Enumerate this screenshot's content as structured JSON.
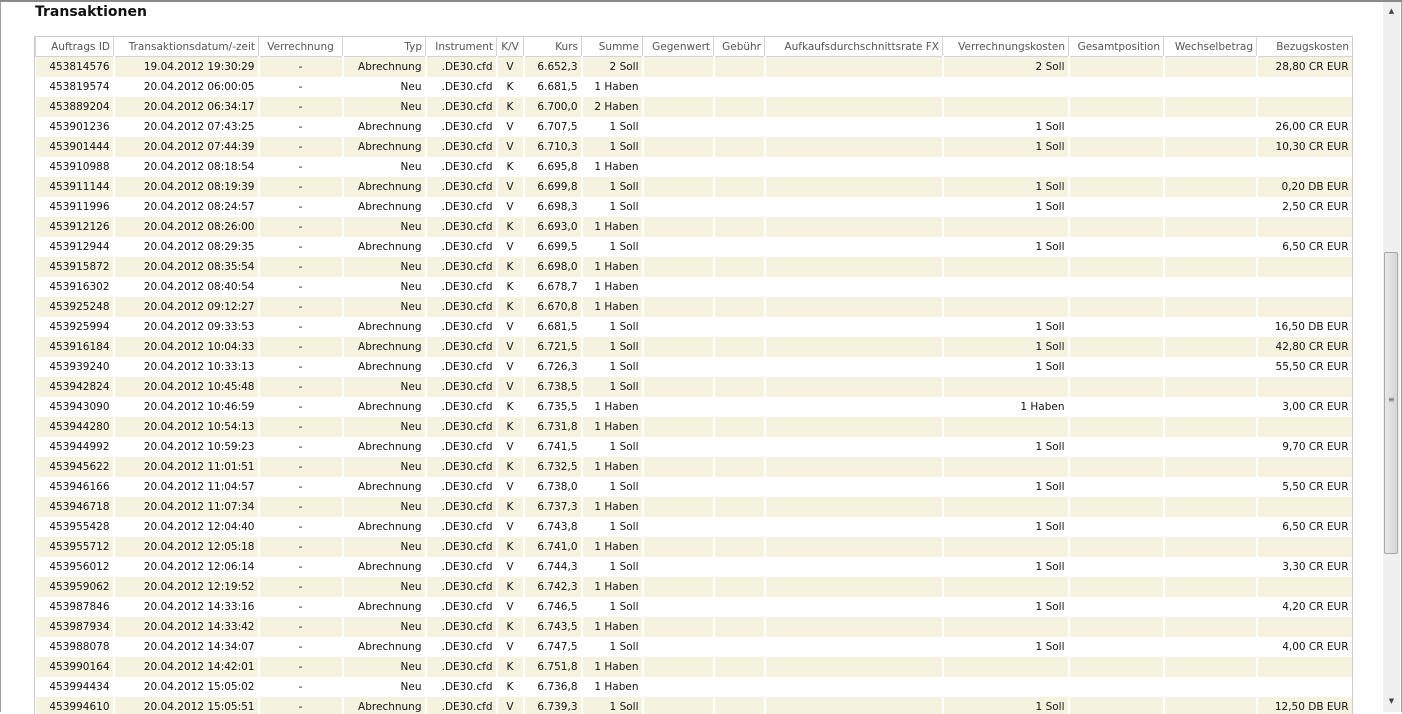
{
  "title": "Transaktionen",
  "table": {
    "columns": [
      "Auftrags ID",
      "Transaktionsdatum/-zeit",
      "Verrechnung",
      "Typ",
      "Instrument",
      "K/V",
      "Kurs",
      "Summe",
      "Gegenwert",
      "Gebühr",
      "Aufkaufsdurchschnittsrate FX",
      "Verrechnungskosten",
      "Gesamtposition",
      "Wechselbetrag",
      "Bezugskosten"
    ],
    "rows": [
      [
        "453814576",
        "19.04.2012 19:30:29",
        "-",
        "Abrechnung",
        ".DE30.cfd",
        "V",
        "6.652,3",
        "2 Soll",
        "",
        "",
        "",
        "2 Soll",
        "",
        "",
        "28,80 CR EUR"
      ],
      [
        "453819574",
        "20.04.2012 06:00:05",
        "-",
        "Neu",
        ".DE30.cfd",
        "K",
        "6.681,5",
        "1 Haben",
        "",
        "",
        "",
        "",
        "",
        "",
        ""
      ],
      [
        "453889204",
        "20.04.2012 06:34:17",
        "-",
        "Neu",
        ".DE30.cfd",
        "K",
        "6.700,0",
        "2 Haben",
        "",
        "",
        "",
        "",
        "",
        "",
        ""
      ],
      [
        "453901236",
        "20.04.2012 07:43:25",
        "-",
        "Abrechnung",
        ".DE30.cfd",
        "V",
        "6.707,5",
        "1 Soll",
        "",
        "",
        "",
        "1 Soll",
        "",
        "",
        "26,00 CR EUR"
      ],
      [
        "453901444",
        "20.04.2012 07:44:39",
        "-",
        "Abrechnung",
        ".DE30.cfd",
        "V",
        "6.710,3",
        "1 Soll",
        "",
        "",
        "",
        "1 Soll",
        "",
        "",
        "10,30 CR EUR"
      ],
      [
        "453910988",
        "20.04.2012 08:18:54",
        "-",
        "Neu",
        ".DE30.cfd",
        "K",
        "6.695,8",
        "1 Haben",
        "",
        "",
        "",
        "",
        "",
        "",
        ""
      ],
      [
        "453911144",
        "20.04.2012 08:19:39",
        "-",
        "Abrechnung",
        ".DE30.cfd",
        "V",
        "6.699,8",
        "1 Soll",
        "",
        "",
        "",
        "1 Soll",
        "",
        "",
        "0,20 DB EUR"
      ],
      [
        "453911996",
        "20.04.2012 08:24:57",
        "-",
        "Abrechnung",
        ".DE30.cfd",
        "V",
        "6.698,3",
        "1 Soll",
        "",
        "",
        "",
        "1 Soll",
        "",
        "",
        "2,50 CR EUR"
      ],
      [
        "453912126",
        "20.04.2012 08:26:00",
        "-",
        "Neu",
        ".DE30.cfd",
        "K",
        "6.693,0",
        "1 Haben",
        "",
        "",
        "",
        "",
        "",
        "",
        ""
      ],
      [
        "453912944",
        "20.04.2012 08:29:35",
        "-",
        "Abrechnung",
        ".DE30.cfd",
        "V",
        "6.699,5",
        "1 Soll",
        "",
        "",
        "",
        "1 Soll",
        "",
        "",
        "6,50 CR EUR"
      ],
      [
        "453915872",
        "20.04.2012 08:35:54",
        "-",
        "Neu",
        ".DE30.cfd",
        "K",
        "6.698,0",
        "1 Haben",
        "",
        "",
        "",
        "",
        "",
        "",
        ""
      ],
      [
        "453916302",
        "20.04.2012 08:40:54",
        "-",
        "Neu",
        ".DE30.cfd",
        "K",
        "6.678,7",
        "1 Haben",
        "",
        "",
        "",
        "",
        "",
        "",
        ""
      ],
      [
        "453925248",
        "20.04.2012 09:12:27",
        "-",
        "Neu",
        ".DE30.cfd",
        "K",
        "6.670,8",
        "1 Haben",
        "",
        "",
        "",
        "",
        "",
        "",
        ""
      ],
      [
        "453925994",
        "20.04.2012 09:33:53",
        "-",
        "Abrechnung",
        ".DE30.cfd",
        "V",
        "6.681,5",
        "1 Soll",
        "",
        "",
        "",
        "1 Soll",
        "",
        "",
        "16,50 DB EUR"
      ],
      [
        "453916184",
        "20.04.2012 10:04:33",
        "-",
        "Abrechnung",
        ".DE30.cfd",
        "V",
        "6.721,5",
        "1 Soll",
        "",
        "",
        "",
        "1 Soll",
        "",
        "",
        "42,80 CR EUR"
      ],
      [
        "453939240",
        "20.04.2012 10:33:13",
        "-",
        "Abrechnung",
        ".DE30.cfd",
        "V",
        "6.726,3",
        "1 Soll",
        "",
        "",
        "",
        "1 Soll",
        "",
        "",
        "55,50 CR EUR"
      ],
      [
        "453942824",
        "20.04.2012 10:45:48",
        "-",
        "Neu",
        ".DE30.cfd",
        "V",
        "6.738,5",
        "1 Soll",
        "",
        "",
        "",
        "",
        "",
        "",
        ""
      ],
      [
        "453943090",
        "20.04.2012 10:46:59",
        "-",
        "Abrechnung",
        ".DE30.cfd",
        "K",
        "6.735,5",
        "1 Haben",
        "",
        "",
        "",
        "1 Haben",
        "",
        "",
        "3,00 CR EUR"
      ],
      [
        "453944280",
        "20.04.2012 10:54:13",
        "-",
        "Neu",
        ".DE30.cfd",
        "K",
        "6.731,8",
        "1 Haben",
        "",
        "",
        "",
        "",
        "",
        "",
        ""
      ],
      [
        "453944992",
        "20.04.2012 10:59:23",
        "-",
        "Abrechnung",
        ".DE30.cfd",
        "V",
        "6.741,5",
        "1 Soll",
        "",
        "",
        "",
        "1 Soll",
        "",
        "",
        "9,70 CR EUR"
      ],
      [
        "453945622",
        "20.04.2012 11:01:51",
        "-",
        "Neu",
        ".DE30.cfd",
        "K",
        "6.732,5",
        "1 Haben",
        "",
        "",
        "",
        "",
        "",
        "",
        ""
      ],
      [
        "453946166",
        "20.04.2012 11:04:57",
        "-",
        "Abrechnung",
        ".DE30.cfd",
        "V",
        "6.738,0",
        "1 Soll",
        "",
        "",
        "",
        "1 Soll",
        "",
        "",
        "5,50 CR EUR"
      ],
      [
        "453946718",
        "20.04.2012 11:07:34",
        "-",
        "Neu",
        ".DE30.cfd",
        "K",
        "6.737,3",
        "1 Haben",
        "",
        "",
        "",
        "",
        "",
        "",
        ""
      ],
      [
        "453955428",
        "20.04.2012 12:04:40",
        "-",
        "Abrechnung",
        ".DE30.cfd",
        "V",
        "6.743,8",
        "1 Soll",
        "",
        "",
        "",
        "1 Soll",
        "",
        "",
        "6,50 CR EUR"
      ],
      [
        "453955712",
        "20.04.2012 12:05:18",
        "-",
        "Neu",
        ".DE30.cfd",
        "K",
        "6.741,0",
        "1 Haben",
        "",
        "",
        "",
        "",
        "",
        "",
        ""
      ],
      [
        "453956012",
        "20.04.2012 12:06:14",
        "-",
        "Abrechnung",
        ".DE30.cfd",
        "V",
        "6.744,3",
        "1 Soll",
        "",
        "",
        "",
        "1 Soll",
        "",
        "",
        "3,30 CR EUR"
      ],
      [
        "453959062",
        "20.04.2012 12:19:52",
        "-",
        "Neu",
        ".DE30.cfd",
        "K",
        "6.742,3",
        "1 Haben",
        "",
        "",
        "",
        "",
        "",
        "",
        ""
      ],
      [
        "453987846",
        "20.04.2012 14:33:16",
        "-",
        "Abrechnung",
        ".DE30.cfd",
        "V",
        "6.746,5",
        "1 Soll",
        "",
        "",
        "",
        "1 Soll",
        "",
        "",
        "4,20 CR EUR"
      ],
      [
        "453987934",
        "20.04.2012 14:33:42",
        "-",
        "Neu",
        ".DE30.cfd",
        "K",
        "6.743,5",
        "1 Haben",
        "",
        "",
        "",
        "",
        "",
        "",
        ""
      ],
      [
        "453988078",
        "20.04.2012 14:34:07",
        "-",
        "Abrechnung",
        ".DE30.cfd",
        "V",
        "6.747,5",
        "1 Soll",
        "",
        "",
        "",
        "1 Soll",
        "",
        "",
        "4,00 CR EUR"
      ],
      [
        "453990164",
        "20.04.2012 14:42:01",
        "-",
        "Neu",
        ".DE30.cfd",
        "K",
        "6.751,8",
        "1 Haben",
        "",
        "",
        "",
        "",
        "",
        "",
        ""
      ],
      [
        "453994434",
        "20.04.2012 15:05:02",
        "-",
        "Neu",
        ".DE30.cfd",
        "K",
        "6.736,8",
        "1 Haben",
        "",
        "",
        "",
        "",
        "",
        "",
        ""
      ],
      [
        "453994610",
        "20.04.2012 15:05:51",
        "-",
        "Abrechnung",
        ".DE30.cfd",
        "V",
        "6.739,3",
        "1 Soll",
        "",
        "",
        "",
        "1 Soll",
        "",
        "",
        "12,50 DB EUR"
      ]
    ]
  },
  "scrollbar": {
    "position_fraction": 0.42,
    "up_icon": "arrow-up-icon",
    "down_icon": "arrow-down-icon"
  }
}
